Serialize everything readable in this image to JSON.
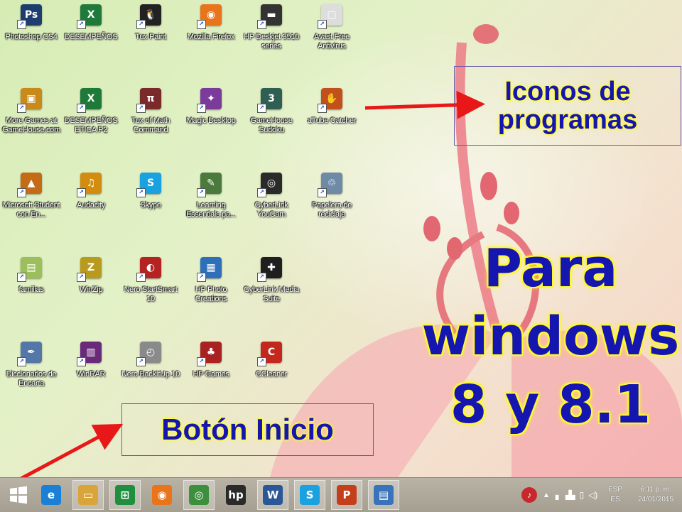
{
  "desktop": {
    "icons": [
      {
        "label": "Photoshop CS4",
        "glyph": "Ps",
        "color": "#1d3d6e",
        "icon": "photoshop-icon"
      },
      {
        "label": "DESEMPEÑOS",
        "glyph": "X",
        "color": "#1f7a3a",
        "icon": "excel-file-icon"
      },
      {
        "label": "Tux Paint",
        "glyph": "🐧",
        "color": "#222222",
        "icon": "tux-paint-icon"
      },
      {
        "label": "Mozilla Firefox",
        "glyph": "◉",
        "color": "#e8741c",
        "icon": "firefox-icon"
      },
      {
        "label": "HP Deskjet 3510 series",
        "glyph": "▬",
        "color": "#333333",
        "icon": "printer-icon"
      },
      {
        "label": "Avast Free Antivirus",
        "glyph": "▢",
        "color": "#dddddd",
        "icon": "file-icon"
      },
      {
        "label": "More Games at GameHouse.com",
        "glyph": "▣",
        "color": "#c88a1a",
        "icon": "gamehouse-icon"
      },
      {
        "label": "DESEMPEÑOS ETICA P2",
        "glyph": "X",
        "color": "#1f7a3a",
        "icon": "excel-file-icon"
      },
      {
        "label": "Tux of Math Command",
        "glyph": "π",
        "color": "#7a2a2a",
        "icon": "tux-math-icon"
      },
      {
        "label": "Magic Desktop",
        "glyph": "✦",
        "color": "#7a3b9a",
        "icon": "magic-desktop-icon"
      },
      {
        "label": "GameHouse Sudoku",
        "glyph": "3",
        "color": "#2f5f52",
        "icon": "sudoku-icon"
      },
      {
        "label": "aTube Catcher",
        "glyph": "✋",
        "color": "#c2501c",
        "icon": "atube-catcher-icon"
      },
      {
        "label": "Microsoft Student con En...",
        "glyph": "▲",
        "color": "#c56b16",
        "icon": "microsoft-student-icon"
      },
      {
        "label": "Audacity",
        "glyph": "♫",
        "color": "#d28c10",
        "icon": "audacity-icon"
      },
      {
        "label": "Skype",
        "glyph": "S",
        "color": "#1aa1e0",
        "icon": "skype-icon"
      },
      {
        "label": "Learning Essentials pa...",
        "glyph": "✎",
        "color": "#4c7a3c",
        "icon": "learning-essentials-icon"
      },
      {
        "label": "CyberLink YouCam",
        "glyph": "◎",
        "color": "#2a2a2a",
        "icon": "youcam-icon"
      },
      {
        "label": "Papelera de reciclaje",
        "glyph": "♲",
        "color": "#6f8aa6",
        "icon": "recycle-bin-icon"
      },
      {
        "label": "familias",
        "glyph": "▤",
        "color": "#9bbf5a",
        "icon": "document-icon"
      },
      {
        "label": "WinZip",
        "glyph": "Z",
        "color": "#b89a1e",
        "icon": "winzip-icon"
      },
      {
        "label": "Nero StartSmart 10",
        "glyph": "◐",
        "color": "#b52222",
        "icon": "nero-startsmart-icon"
      },
      {
        "label": "HP Photo Creations",
        "glyph": "▦",
        "color": "#2d6fb8",
        "icon": "hp-photo-icon"
      },
      {
        "label": "CyberLink Media Suite",
        "glyph": "✚",
        "color": "#1f1f1f",
        "icon": "media-suite-icon"
      },
      {
        "label": "Diccionarios de Encarta",
        "glyph": "✒",
        "color": "#5477a8",
        "icon": "encarta-icon"
      },
      {
        "label": "WinRAR",
        "glyph": "▥",
        "color": "#6a2a7a",
        "icon": "winrar-icon"
      },
      {
        "label": "Nero BackItUp 10",
        "glyph": "◴",
        "color": "#8a8a8a",
        "icon": "nero-backitup-icon"
      },
      {
        "label": "HP Games",
        "glyph": "♣",
        "color": "#a82222",
        "icon": "hp-games-icon"
      },
      {
        "label": "CCleaner",
        "glyph": "C",
        "color": "#c4281c",
        "icon": "ccleaner-icon"
      }
    ]
  },
  "callouts": {
    "programs": "Iconos de programas",
    "start": "Botón Inicio",
    "title": "Para windows 8 y 8.1"
  },
  "taskbar": {
    "start": {
      "glyph": "⊞",
      "icon": "windows-start-icon"
    },
    "items": [
      {
        "glyph": "e",
        "color": "#1c7fd6",
        "icon": "internet-explorer-icon",
        "active": false
      },
      {
        "glyph": "▭",
        "color": "#d9a53a",
        "icon": "file-explorer-icon",
        "active": true
      },
      {
        "glyph": "⊞",
        "color": "#1f8f3f",
        "icon": "store-icon",
        "active": true
      },
      {
        "glyph": "◉",
        "color": "#e8741c",
        "icon": "firefox-icon",
        "active": false
      },
      {
        "glyph": "◎",
        "color": "#3c8f3c",
        "icon": "chrome-icon",
        "active": true
      },
      {
        "glyph": "hp",
        "color": "#2a2a2a",
        "icon": "hp-icon",
        "active": false
      },
      {
        "glyph": "W",
        "color": "#2b5797",
        "icon": "word-icon",
        "active": true
      },
      {
        "glyph": "S",
        "color": "#1aa1e0",
        "icon": "skype-icon",
        "active": true
      },
      {
        "glyph": "P",
        "color": "#c43e1c",
        "icon": "powerpoint-icon",
        "active": true
      },
      {
        "glyph": "▤",
        "color": "#3a73b8",
        "icon": "control-panel-icon",
        "active": true
      }
    ],
    "tray": {
      "lang": "ESP",
      "region": "ES",
      "time": "6:11 p. m.",
      "date": "24/01/2015"
    }
  }
}
